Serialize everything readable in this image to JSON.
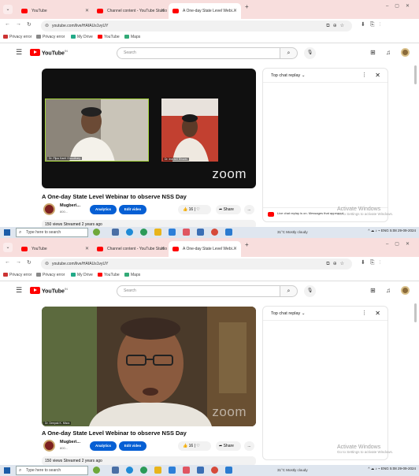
{
  "browser": {
    "tabs": [
      {
        "label": "YouTube"
      },
      {
        "label": "Channel content - YouTube Studio"
      },
      {
        "label": "A One-day State Level Webi..."
      }
    ],
    "url": "youtube.com/live/HAfAUs1vyUY",
    "bookmarks": [
      "Privacy error",
      "Privacy error",
      "My Drive",
      "YouTube",
      "Maps"
    ]
  },
  "youtube": {
    "logo_text": "YouTube",
    "logo_region": "IN",
    "search_placeholder": "Search"
  },
  "video": {
    "title": "A One-day State Level Webinar to observe NSS Day",
    "channel_name": "Mugberi...",
    "channel_subs": "800...",
    "analytics_label": "Analytics",
    "edit_label": "Edit video",
    "likes": "16",
    "share_label": "Share",
    "more_label": "...",
    "meta": "150 views  Streamed 2 years ago",
    "zoom_watermark": "zoom",
    "participant_1": "Dr. Pijus Kanti Choudhary",
    "participant_2": "Dr. Indranil Biswas",
    "speaker_label": "Dr. Deepak K. Misra"
  },
  "chat": {
    "header": "Top chat replay",
    "footer": "Live chat replay is on. Messages that appeared"
  },
  "windows": {
    "activate_title": "Activate Windows",
    "activate_sub": "Go to Settings to activate Windows.",
    "search_placeholder": "Type here to search",
    "weather": "31°C  Mostly cloudy",
    "language": "ENG",
    "time": "5:08",
    "date": "29-09-2024"
  },
  "colors": {
    "tab_bar": "#f8dedd",
    "youtube_red": "#ff0000",
    "accent_blue": "#065fd4"
  }
}
